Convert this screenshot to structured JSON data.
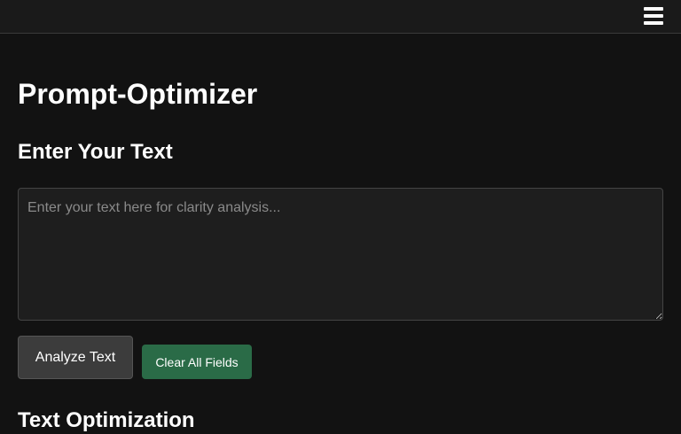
{
  "header": {
    "menu_icon": "hamburger-menu-icon"
  },
  "main": {
    "title": "Prompt-Optimizer",
    "input_section": {
      "heading": "Enter Your Text",
      "placeholder": "Enter your text here for clarity analysis...",
      "value": ""
    },
    "actions": {
      "analyze_label": "Analyze Text",
      "clear_label": "Clear All Fields"
    },
    "optimization_section": {
      "heading": "Text Optimization"
    }
  },
  "colors": {
    "background": "#121212",
    "topbar": "#1a1a1a",
    "input_background": "#1e1e1e",
    "analyze_button": "#3c3c3c",
    "clear_button": "#2a6b47",
    "text": "#ffffff",
    "placeholder": "#8a8a8a"
  }
}
